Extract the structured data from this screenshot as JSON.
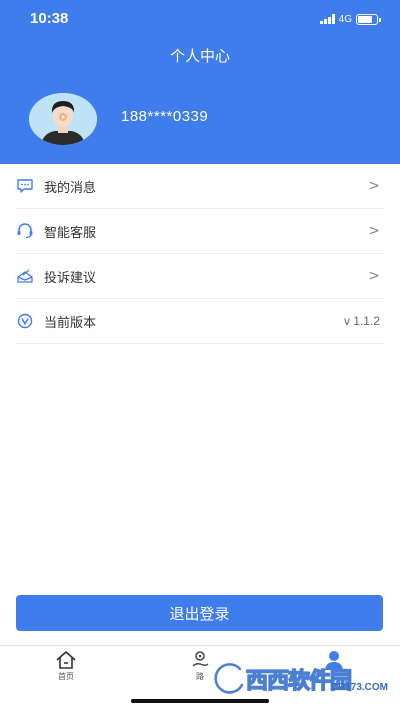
{
  "status_bar": {
    "time": "10:38",
    "network": "4G"
  },
  "header": {
    "title": "个人中心",
    "phone": "188****0339"
  },
  "menu": {
    "items": [
      {
        "label": "我的消息",
        "icon": "message-icon"
      },
      {
        "label": "智能客服",
        "icon": "headset-icon"
      },
      {
        "label": "投诉建议",
        "icon": "feedback-icon"
      },
      {
        "label": "当前版本",
        "icon": "version-icon",
        "value": "v 1.1.2"
      }
    ]
  },
  "logout": {
    "label": "退出登录"
  },
  "tabbar": {
    "tabs": [
      {
        "label": "首页",
        "icon": "home-icon"
      },
      {
        "label": "路",
        "icon": "route-icon"
      },
      {
        "label": "",
        "icon": "profile-icon"
      }
    ]
  },
  "watermark": {
    "text": "西西软件园",
    "sub": "CR173.COM"
  },
  "colors": {
    "primary": "#3f7ded",
    "avatar_bg": "#bfe2f5"
  }
}
